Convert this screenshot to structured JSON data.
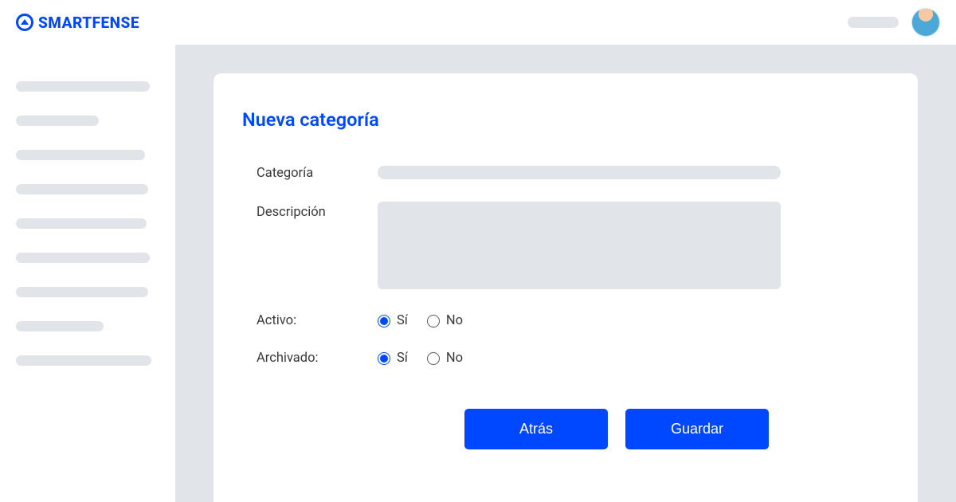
{
  "brand": {
    "name": "SMARTFENSE"
  },
  "page": {
    "title": "Nueva categoría"
  },
  "form": {
    "categoria_label": "Categoría",
    "descripcion_label": "Descripción",
    "activo_label": "Activo:",
    "archivado_label": "Archivado:",
    "yes": "Sí",
    "no": "No",
    "activo_value": "yes",
    "archivado_value": "yes"
  },
  "buttons": {
    "back": "Atrás",
    "save": "Guardar"
  },
  "colors": {
    "primary": "#0048ff",
    "skeleton": "#e1e5ea"
  }
}
